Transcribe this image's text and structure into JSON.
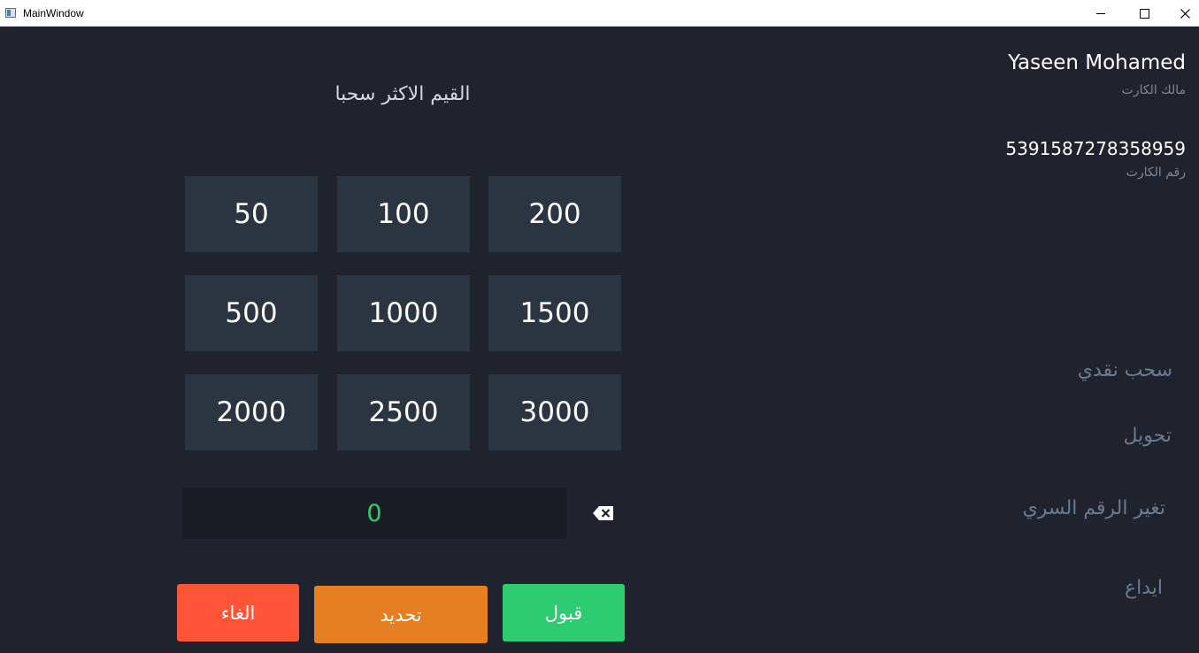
{
  "window": {
    "title": "MainWindow",
    "minimize_icon": "minimize-icon",
    "maximize_icon": "maximize-icon",
    "close_icon": "close-icon"
  },
  "card": {
    "owner_name": "Yaseen Mohamed",
    "owner_label": "مالك الكارت",
    "number": "5391587278358959",
    "number_label": "رقم الكارت"
  },
  "nav": {
    "withdraw": "سحب نقدي",
    "transfer": "تحويل",
    "change_pin": "تغير الرقم السري",
    "deposit": "ايداع"
  },
  "heading": "القيم الاكثر سحبا",
  "amounts": [
    "50",
    "100",
    "200",
    "500",
    "1000",
    "1500",
    "2000",
    "2500",
    "3000"
  ],
  "input": {
    "value": "0",
    "backspace_icon": "backspace-icon"
  },
  "actions": {
    "cancel": "الغاء",
    "update": "تحديد",
    "accept": "قبول"
  },
  "colors": {
    "background": "#1f232d",
    "tile": "#2b3441",
    "input_bg": "#181c24",
    "input_text": "#2ecc71",
    "cancel": "#ff5436",
    "update": "#e67e22",
    "accept": "#2ecc71",
    "nav_text": "#6c7a90"
  }
}
